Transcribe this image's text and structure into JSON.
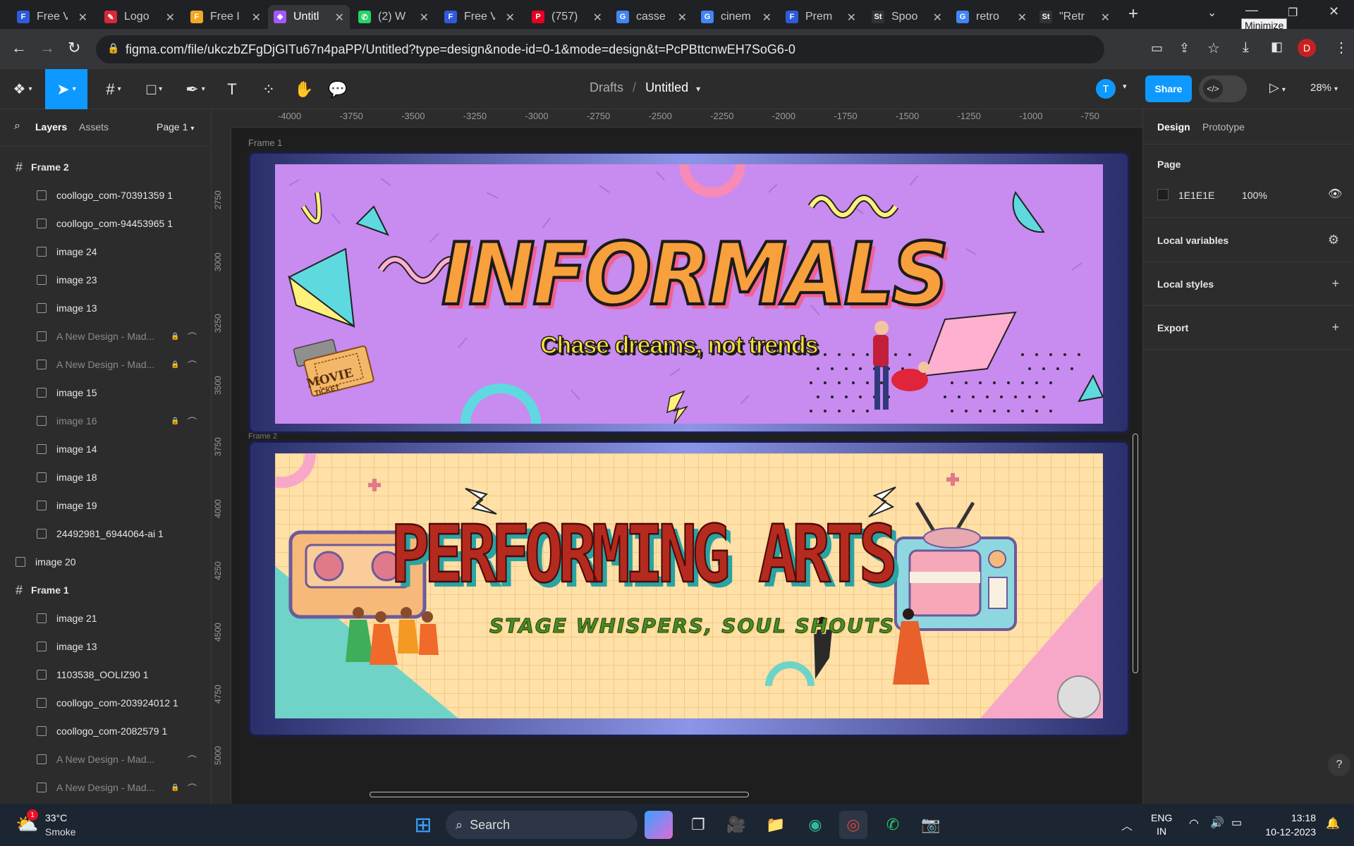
{
  "browser": {
    "tabs": [
      {
        "title": "Free V",
        "icon": "figma-blue-icon"
      },
      {
        "title": "Logo",
        "icon": "logo-red-icon"
      },
      {
        "title": "Free I",
        "icon": "f-orange-icon"
      },
      {
        "title": "Untitl",
        "icon": "figma-icon",
        "active": true
      },
      {
        "title": "(2) W",
        "icon": "whatsapp-icon"
      },
      {
        "title": "Free V",
        "icon": "figma-blue-icon"
      },
      {
        "title": "(757)",
        "icon": "pinterest-icon"
      },
      {
        "title": "casse",
        "icon": "google-icon"
      },
      {
        "title": "cinem",
        "icon": "google-icon"
      },
      {
        "title": "Prem",
        "icon": "figma-blue-icon"
      },
      {
        "title": "Spoo",
        "icon": "st-icon"
      },
      {
        "title": "retro",
        "icon": "google-icon"
      },
      {
        "title": "\"Retr",
        "icon": "st-icon"
      }
    ],
    "url": "figma.com/file/ukczbZFgDjGITu67n4paPP/Untitled?type=design&node-id=0-1&mode=design&t=PcPBttcnwEH7SoG6-0",
    "tooltip": "Minimize",
    "profile_initial": "D"
  },
  "figma": {
    "breadcrumb_parent": "Drafts",
    "breadcrumb_sep": "/",
    "file_name": "Untitled",
    "avatar_initial": "T",
    "share_label": "Share",
    "zoom": "28%",
    "left_tabs": {
      "layers": "Layers",
      "assets": "Assets",
      "page": "Page 1"
    },
    "layers": [
      {
        "name": "Frame 2",
        "type": "frame",
        "indent": 0
      },
      {
        "name": "coollogo_com-70391359 1",
        "type": "image",
        "indent": 1
      },
      {
        "name": "coollogo_com-94453965 1",
        "type": "image",
        "indent": 1
      },
      {
        "name": "image 24",
        "type": "image",
        "indent": 1
      },
      {
        "name": "image 23",
        "type": "image",
        "indent": 1
      },
      {
        "name": "image 13",
        "type": "image",
        "indent": 1
      },
      {
        "name": "A New Design - Mad...",
        "type": "image",
        "indent": 1,
        "locked": true,
        "hidden": true
      },
      {
        "name": "A New Design - Mad...",
        "type": "image",
        "indent": 1,
        "locked": true,
        "hidden": true
      },
      {
        "name": "image 15",
        "type": "image",
        "indent": 1
      },
      {
        "name": "image 16",
        "type": "image",
        "indent": 1,
        "locked": true,
        "hidden": true
      },
      {
        "name": "image 14",
        "type": "image",
        "indent": 1
      },
      {
        "name": "image 18",
        "type": "image",
        "indent": 1
      },
      {
        "name": "image 19",
        "type": "image",
        "indent": 1
      },
      {
        "name": "24492981_6944064-ai 1",
        "type": "image",
        "indent": 1
      },
      {
        "name": "image 20",
        "type": "image",
        "indent": 0
      },
      {
        "name": "Frame 1",
        "type": "frame",
        "indent": 0
      },
      {
        "name": "image 21",
        "type": "image",
        "indent": 1
      },
      {
        "name": "image 13",
        "type": "image",
        "indent": 1
      },
      {
        "name": "1103538_OOLIZ90 1",
        "type": "image",
        "indent": 1
      },
      {
        "name": "coollogo_com-203924012 1",
        "type": "image",
        "indent": 1
      },
      {
        "name": "coollogo_com-2082579 1",
        "type": "image",
        "indent": 1
      },
      {
        "name": "A New Design - Mad...",
        "type": "image",
        "indent": 1,
        "hidden": true
      },
      {
        "name": "A New Design - Mad...",
        "type": "image",
        "indent": 1,
        "locked": true,
        "hidden": true
      }
    ],
    "ruler_h": [
      "-4000",
      "-3750",
      "-3500",
      "-3250",
      "-3000",
      "-2750",
      "-2500",
      "-2250",
      "-2000",
      "-1750",
      "-1500",
      "-1250",
      "-1000",
      "-750"
    ],
    "ruler_v": [
      "2750",
      "3000",
      "3250",
      "3500",
      "3750",
      "4000",
      "4250",
      "4500",
      "4750",
      "5000"
    ],
    "frame_label_1": "Frame 1",
    "frame_label_2": "Frame 2",
    "banner1": {
      "title": "INFORMALS",
      "subtitle": "Chase dreams, not trends",
      "ticket_text": "MOVIE",
      "ticket_sub": "TICKET"
    },
    "banner2": {
      "title": "PERFORMING ARTS",
      "subtitle": "STAGE WHISPERS, SOUL SHOUTS"
    },
    "right": {
      "tabs": {
        "design": "Design",
        "prototype": "Prototype"
      },
      "page_title": "Page",
      "bg_hex": "1E1E1E",
      "bg_opacity": "100%",
      "sections": [
        "Local variables",
        "Local styles",
        "Export"
      ]
    },
    "help": "?"
  },
  "taskbar": {
    "weather_temp": "33°C",
    "weather_desc": "Smoke",
    "search": "Search",
    "lang1": "ENG",
    "lang2": "IN",
    "time": "13:18",
    "date": "10-12-2023",
    "badge": "1"
  },
  "colors": {
    "figma_blue": "#0d99ff",
    "banner1_bg": "#c88bf0",
    "banner2_bg": "#ffe0a6",
    "informals_orange": "#f7a03c",
    "performing_red": "#b52a1e"
  }
}
